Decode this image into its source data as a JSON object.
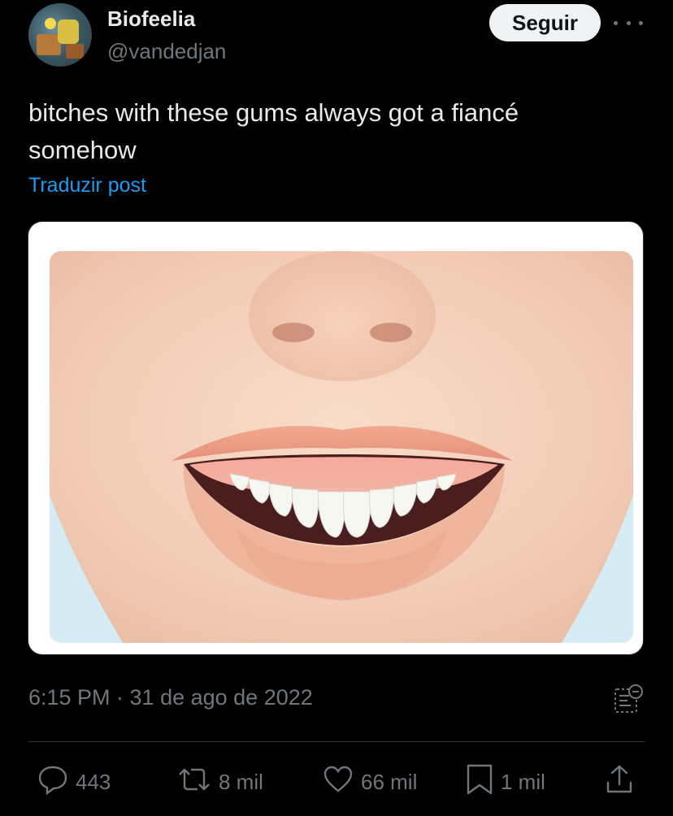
{
  "author": {
    "display_name": "Biofeelia",
    "handle": "@vandedjan"
  },
  "follow_label": "Seguir",
  "tweet": {
    "line1": "bitches with these gums always got a fiancé",
    "line2": "somehow",
    "translate_label": "Traduzir post"
  },
  "timestamp": "6:15 PM · 31 de ago de 2022",
  "actions": {
    "replies": "443",
    "reposts": "8 mil",
    "likes": "66 mil",
    "bookmarks": "1 mil"
  },
  "colors": {
    "background": "#000000",
    "text": "#e7e9ea",
    "muted": "#71767b",
    "link": "#1d9bf0",
    "follow_bg": "#eff3f4"
  },
  "icons": [
    "more-icon",
    "views-icon",
    "reply-icon",
    "repost-icon",
    "like-icon",
    "bookmark-icon",
    "share-icon"
  ]
}
